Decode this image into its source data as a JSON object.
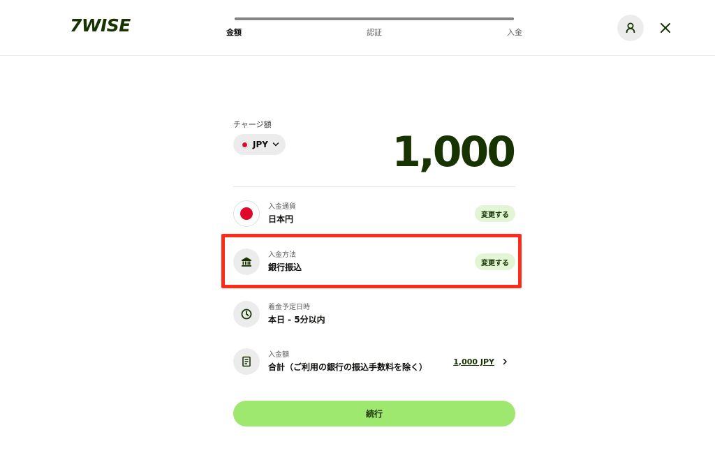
{
  "header": {
    "logo_text": "7WISE",
    "steps": [
      {
        "label": "金額",
        "active": true
      },
      {
        "label": "認証",
        "active": false
      },
      {
        "label": "入金",
        "active": false
      }
    ]
  },
  "amount": {
    "label": "チャージ額",
    "currency_code": "JPY",
    "value": "1,000"
  },
  "rows": [
    {
      "sub": "入金通貨",
      "main": "日本円",
      "action": "変更する",
      "icon": "japan-flag-icon"
    },
    {
      "sub": "入金方法",
      "main": "銀行振込",
      "action": "変更する",
      "icon": "bank-icon"
    },
    {
      "sub": "着金予定日時",
      "main": "本日 - 5分以内",
      "icon": "clock-icon"
    },
    {
      "sub": "入金額",
      "main": "合計（ご利用の銀行の振込手数料を除く）",
      "amount_link": "1,000 JPY",
      "icon": "receipt-icon"
    }
  ],
  "continue_label": "続行",
  "colors": {
    "brand_dark": "#163300",
    "accent_green": "#9fe870",
    "pill_green": "#e2f6d5",
    "highlight_red": "#ff2a17",
    "flag_red": "#e0072b"
  }
}
